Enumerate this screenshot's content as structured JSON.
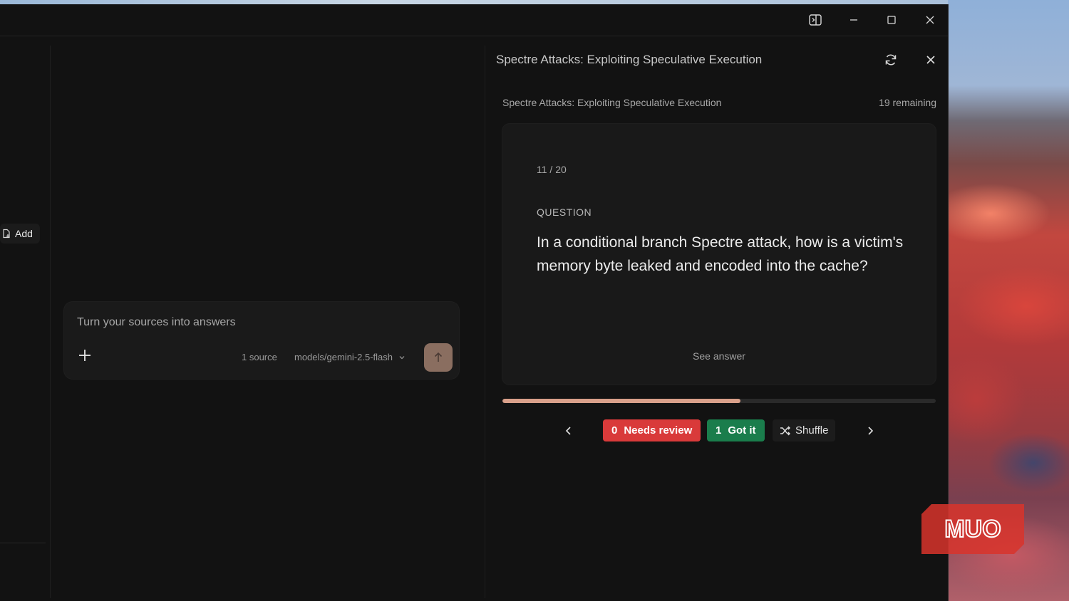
{
  "window": {
    "controls": [
      "sidebar-toggle-icon",
      "minimize-icon",
      "maximize-icon",
      "close-icon"
    ]
  },
  "sidebar": {
    "add_label": "Add"
  },
  "composer": {
    "placeholder": "Turn your sources into answers",
    "source_count": "1 source",
    "model": "models/gemini-2.5-flash"
  },
  "flashcards": {
    "panel_title": "Spectre Attacks: Exploiting Speculative Execution",
    "subtitle": "Spectre Attacks: Exploiting Speculative Execution",
    "remaining": "19 remaining",
    "counter": "11 / 20",
    "label": "QUESTION",
    "question": "In a conditional branch Spectre attack, how is a victim's memory byte leaked and encoded into the cache?",
    "see_answer": "See answer",
    "progress": 0.55,
    "needs_review_count": "0",
    "needs_review_label": "Needs review",
    "got_it_count": "1",
    "got_it_label": "Got it",
    "shuffle_label": "Shuffle"
  },
  "colors": {
    "accent_send": "#8a6e60",
    "progress_fill": "#d9a08a",
    "needs_review": "#d93a3a",
    "got_it": "#1a7d4c"
  },
  "watermark": {
    "text": "MUO"
  }
}
